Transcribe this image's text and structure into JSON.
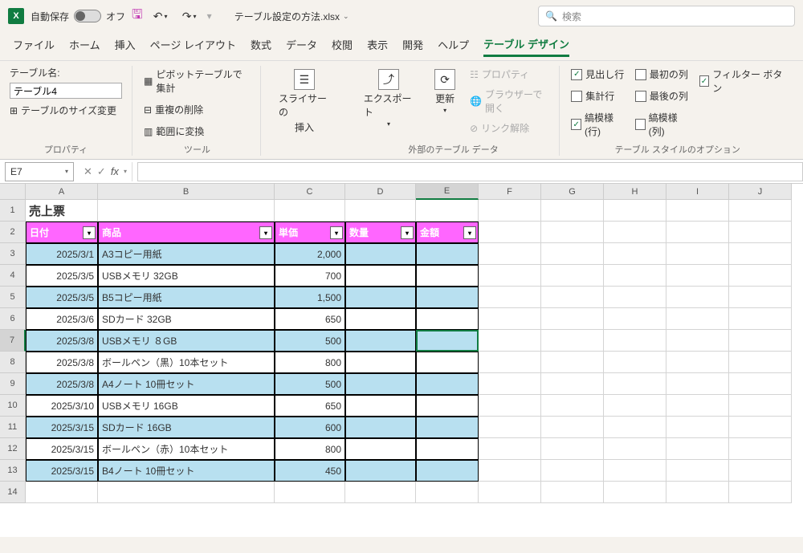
{
  "titlebar": {
    "autosave_label": "自動保存",
    "autosave_state": "オフ",
    "filename": "テーブル設定の方法.xlsx",
    "search_placeholder": "検索"
  },
  "tabs": [
    "ファイル",
    "ホーム",
    "挿入",
    "ページ レイアウト",
    "数式",
    "データ",
    "校閲",
    "表示",
    "開発",
    "ヘルプ",
    "テーブル デザイン"
  ],
  "active_tab": "テーブル デザイン",
  "ribbon": {
    "props": {
      "label": "テーブル名:",
      "name_value": "テーブル4",
      "resize": "テーブルのサイズ変更",
      "group": "プロパティ"
    },
    "tools": {
      "pivot": "ピボットテーブルで集計",
      "dedup": "重複の削除",
      "range": "範囲に変換",
      "group": "ツール"
    },
    "slicer": {
      "line1": "スライサーの",
      "line2": "挿入"
    },
    "export": {
      "label": "エクスポート"
    },
    "refresh": {
      "label": "更新"
    },
    "extdata": {
      "prop": "プロパティ",
      "browser": "ブラウザーで開く",
      "unlink": "リンク解除",
      "group": "外部のテーブル データ"
    },
    "styleopts": {
      "header_row": "見出し行",
      "total_row": "集計行",
      "banded_rows": "縞模様 (行)",
      "first_col": "最初の列",
      "last_col": "最後の列",
      "banded_cols": "縞模様 (列)",
      "filter_btn": "フィルター ボタン",
      "group": "テーブル スタイルのオプション"
    }
  },
  "formula": {
    "name_box": "E7"
  },
  "sheet": {
    "title": "売上票",
    "columns": [
      "日付",
      "商品",
      "単価",
      "数量",
      "金額"
    ],
    "rows": [
      {
        "date": "2025/3/1",
        "item": "A3コピー用紙",
        "price": "2,000"
      },
      {
        "date": "2025/3/5",
        "item": "USBメモリ 32GB",
        "price": "700"
      },
      {
        "date": "2025/3/5",
        "item": "B5コピー用紙",
        "price": "1,500"
      },
      {
        "date": "2025/3/6",
        "item": "SDカード 32GB",
        "price": "650"
      },
      {
        "date": "2025/3/8",
        "item": "USBメモリ ８GB",
        "price": "500"
      },
      {
        "date": "2025/3/8",
        "item": "ボールペン（黒）10本セット",
        "price": "800"
      },
      {
        "date": "2025/3/8",
        "item": "A4ノート 10冊セット",
        "price": "500"
      },
      {
        "date": "2025/3/10",
        "item": "USBメモリ 16GB",
        "price": "650"
      },
      {
        "date": "2025/3/15",
        "item": "SDカード 16GB",
        "price": "600"
      },
      {
        "date": "2025/3/15",
        "item": "ボールペン（赤）10本セット",
        "price": "800"
      },
      {
        "date": "2025/3/15",
        "item": "B4ノート 10冊セット",
        "price": "450"
      }
    ]
  }
}
